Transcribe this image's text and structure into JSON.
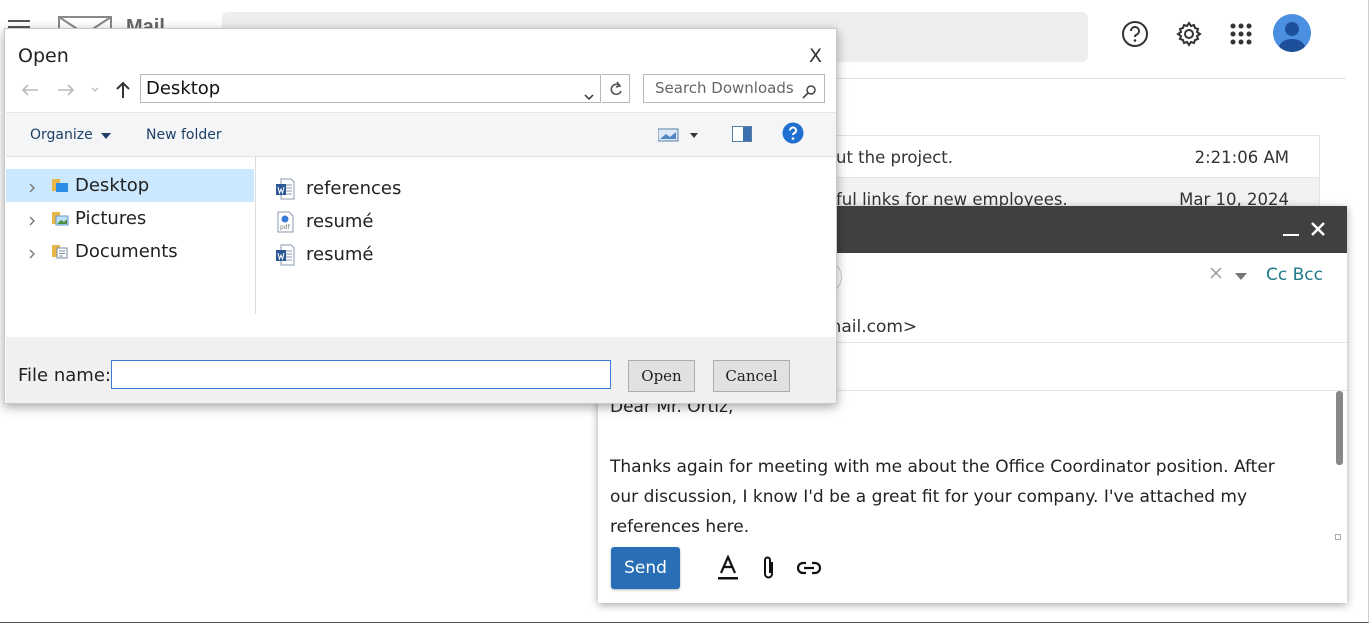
{
  "mail_header": {
    "title": "Mail"
  },
  "inbox": {
    "rows": [
      {
        "snippet": "ut the project.",
        "time": "2:21:06 AM"
      },
      {
        "snippet": "ful links for new employees.",
        "time": "Mar 10, 2024"
      }
    ]
  },
  "compose": {
    "cc_bcc": "Cc Bcc",
    "from": "gmail.com>",
    "body_lines": [
      "Dear Mr. Ortiz,",
      "",
      "Thanks again for meeting with me about the Office Coordinator position. After",
      "our discussion, I know I'd be a great fit for your company. I've attached my",
      "references here."
    ],
    "send_label": "Send"
  },
  "open_dialog": {
    "title": "Open",
    "close_label": "X",
    "path": "Desktop",
    "search_placeholder": "Search Downloads",
    "commands": {
      "organize": "Organize",
      "new_folder": "New folder"
    },
    "tree": [
      {
        "label": "Desktop",
        "selected": true
      },
      {
        "label": "Pictures",
        "selected": false
      },
      {
        "label": "Documents",
        "selected": false
      }
    ],
    "files": [
      {
        "name": "references",
        "type": "word"
      },
      {
        "name": "resumé",
        "type": "pdf"
      },
      {
        "name": "resumé",
        "type": "word"
      }
    ],
    "file_name_label": "File name:",
    "file_name_value": "",
    "open_label": "Open",
    "cancel_label": "Cancel"
  },
  "colors": {
    "send_button": "#2a6fb5",
    "compose_bar": "#404040",
    "tree_selection": "#cce8ff",
    "link_teal": "#1f7a8c",
    "avatar": "#4a8fe0"
  }
}
